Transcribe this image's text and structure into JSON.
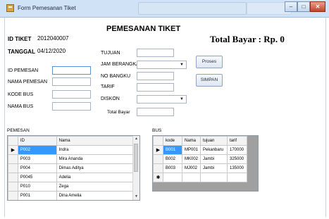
{
  "window": {
    "title": "Form Pemesanan Tiket",
    "min_glyph": "–",
    "max_glyph": "□",
    "close_glyph": "✕"
  },
  "header": {
    "heading": "PEMESANAN TIKET",
    "total_label": "Total Bayar : Rp. 0"
  },
  "left_form": {
    "id_tiket_label": "ID TIKET",
    "id_tiket_value": "2012040007",
    "tanggal_label": "TANGGAL",
    "tanggal_value": "04/12/2020",
    "id_pemesan_label": "ID PEMESAN",
    "nama_pemesan_label": "NAMA PEMESAN",
    "kode_bus_label": "KODE BUS",
    "nama_bus_label": "NAMA BUS"
  },
  "right_form": {
    "tujuan_label": "TUJUAN",
    "jam_berangkat_label": "JAM BERANGKAT",
    "no_bangku_label": "NO BANGKU",
    "tarif_label": "TARIF",
    "diskon_label": "DISKON",
    "total_bayar_label": "Total Bayar"
  },
  "buttons": {
    "proses": "Proses",
    "simpan": "SIMPAN"
  },
  "pemesan_grid": {
    "caption": "PEMESAN",
    "columns": [
      "ID",
      "Nama"
    ],
    "rows": [
      {
        "id": "P002",
        "nama": "Indra"
      },
      {
        "id": "P003",
        "nama": "Mira Ananda"
      },
      {
        "id": "P004",
        "nama": "Dimas Aditya"
      },
      {
        "id": "P0045",
        "nama": "Adelia"
      },
      {
        "id": "P010",
        "nama": "Zega"
      },
      {
        "id": "P001",
        "nama": "Dina Amelia"
      }
    ],
    "current_row_marker": "▶"
  },
  "bus_grid": {
    "caption": "BUS",
    "columns": [
      "kode",
      "Nama",
      "tujuan",
      "tarif"
    ],
    "rows": [
      {
        "kode": "B001",
        "nama": "MP001",
        "tujuan": "Pekanbaru",
        "tarif": "170000"
      },
      {
        "kode": "B002",
        "nama": "MK002",
        "tujuan": "Jambi",
        "tarif": "325000"
      },
      {
        "kode": "B003",
        "nama": "MJ002",
        "tujuan": "Jambi",
        "tarif": "135000"
      }
    ],
    "current_row_marker": "▶",
    "new_row_marker": "✱"
  },
  "colors": {
    "selection": "#3399ff",
    "grid_background": "#a0a0a0"
  }
}
